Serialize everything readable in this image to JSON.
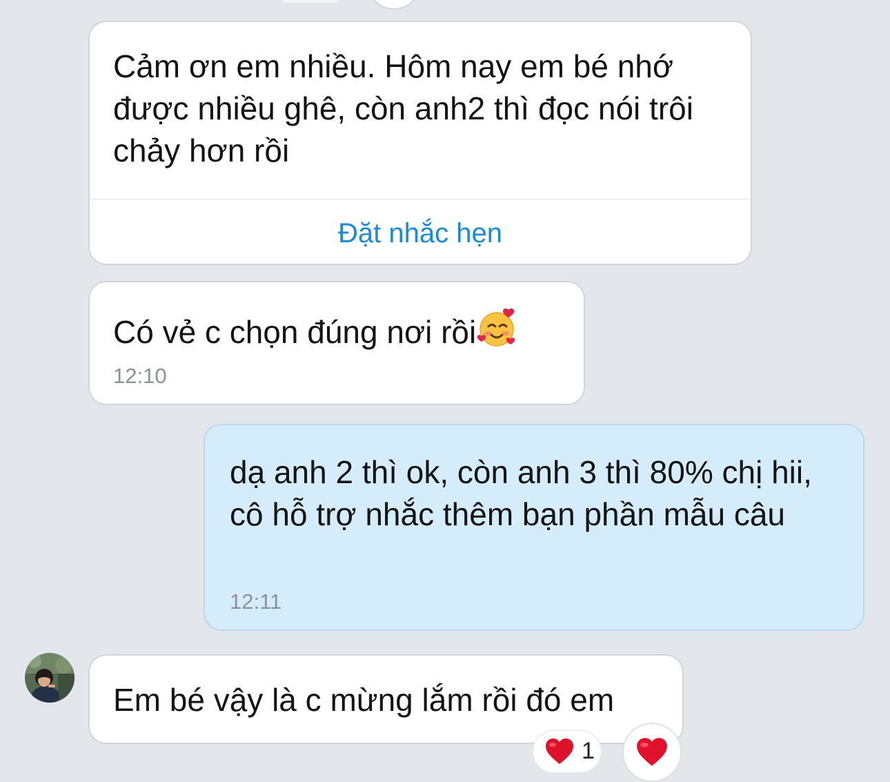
{
  "messages": [
    {
      "id": "m1",
      "direction": "incoming",
      "text": "Cảm ơn em nhiều. Hôm nay em bé nhớ được nhiều ghê, còn anh2 thì đọc nói trôi chảy hơn rồi",
      "action_label": "Đặt nhắc hẹn"
    },
    {
      "id": "m2",
      "direction": "incoming",
      "text": "Có vẻ c chọn đúng nơi rồi",
      "emoji_icon": "smiling-face-with-hearts-icon",
      "time": "12:10"
    },
    {
      "id": "m3",
      "direction": "outgoing",
      "text": "dạ anh 2 thì ok, còn anh 3 thì 80% chị hii, cô hỗ trợ nhắc thêm bạn phần mẫu câu",
      "time": "12:11"
    },
    {
      "id": "m4",
      "direction": "incoming",
      "text": "Em bé vậy là c mừng lắm rồi đó em",
      "reaction": {
        "icon": "heart-icon",
        "count": "1"
      }
    }
  ],
  "colors": {
    "background": "#e3e6ea",
    "incoming_bubble": "#ffffff",
    "outgoing_bubble": "#d5edfb",
    "link": "#1a8ad9",
    "timestamp": "#8c9197",
    "heart": "#e0122b"
  }
}
